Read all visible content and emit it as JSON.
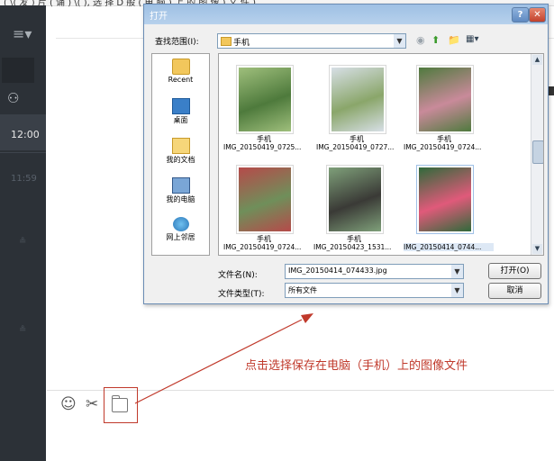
{
  "top_strip_text": "( \\( 发 )  片 ( 诵 )  \\(    ), 选 择 D 般 ( 电 脑 ) 上 的 图 像 ) 文 件 )",
  "sidebar": {
    "menu_glyph": "≡▾",
    "contact_glyph": "⚇",
    "time_selected": "12:00",
    "time_other": "11:59",
    "item_glyph": "≗"
  },
  "dialog": {
    "title": "打开",
    "help_glyph": "?",
    "close_glyph": "✕",
    "look_in_label": "查找范围(I):",
    "look_in_value": "手机",
    "toolbar": {
      "back": "◉",
      "up": "⬆",
      "new_folder": "📁",
      "view": "▦▾"
    },
    "places": [
      {
        "label": "Recent"
      },
      {
        "label": "桌面"
      },
      {
        "label": "我的文档"
      },
      {
        "label": "我的电脑"
      },
      {
        "label": "网上邻居"
      }
    ],
    "files": [
      {
        "line1": "手机",
        "line2": "IMG_20150419_0725...",
        "colors": [
          "#4e7a3c",
          "#9fbf7c"
        ]
      },
      {
        "line1": "手机",
        "line2": "IMG_20150419_0727...",
        "colors": [
          "#8aa66a",
          "#d7dfe6"
        ]
      },
      {
        "line1": "手机",
        "line2": "IMG_20150419_0724...",
        "colors": [
          "#c98a9a",
          "#4f7a3e"
        ]
      },
      {
        "line1": "手机",
        "line2": "IMG_20150419_0724...",
        "colors": [
          "#6f8f5a",
          "#b64a4a"
        ]
      },
      {
        "line1": "手机",
        "line2": "IMG_20150423_1531...",
        "colors": [
          "#3a3a36",
          "#7fa07a"
        ]
      },
      {
        "line1": "",
        "line2": "IMG_20150414_0744...",
        "colors": [
          "#e05a7a",
          "#2f6a3a"
        ]
      }
    ],
    "file_name_label": "文件名(N):",
    "file_name_value": "IMG_20150414_074433.jpg",
    "file_type_label": "文件类型(T):",
    "file_type_value": "所有文件",
    "open_button": "打开(O)",
    "cancel_button": "取消",
    "dropdown_glyph": "▼",
    "scroll_up": "▲",
    "scroll_down": "▼"
  },
  "toolbar": {
    "emoji": "☺",
    "scissors": "✂"
  },
  "annotation": "点击选择保存在电脑（手机）上的图像文件",
  "colors": {
    "annotation": "#c0392b",
    "sidebar": "#2c3137",
    "dialog_frame": "#bcd3ea"
  }
}
